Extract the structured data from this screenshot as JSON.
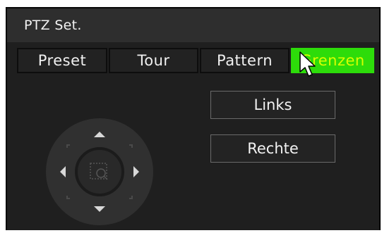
{
  "window": {
    "title": "PTZ Set."
  },
  "tabs": [
    {
      "label": "Preset",
      "active": false
    },
    {
      "label": "Tour",
      "active": false
    },
    {
      "label": "Pattern",
      "active": false
    },
    {
      "label": "Grenzen",
      "active": true
    }
  ],
  "buttons": {
    "left_label": "Links",
    "right_label": "Rechte"
  },
  "ptz": {
    "up_icon": "arrow-up-icon",
    "down_icon": "arrow-down-icon",
    "left_icon": "arrow-left-icon",
    "right_icon": "arrow-right-icon",
    "center_icon": "zoom-icon"
  },
  "colors": {
    "active_tab_bg": "#2ddc0a",
    "active_tab_text": "#d8ff00",
    "window_bg": "#1f1f1f",
    "titlebar_bg": "#2e2e2e"
  }
}
